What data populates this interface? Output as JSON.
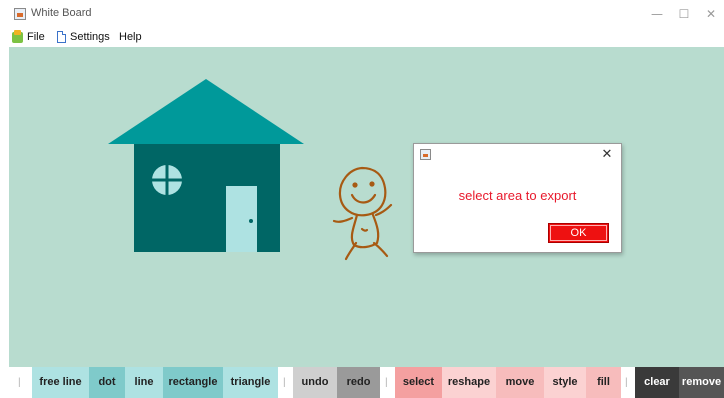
{
  "window": {
    "title": "White Board",
    "app_icon": "java-cup-icon",
    "controls": {
      "minimize": "—",
      "maximize": "☐",
      "close": "✕"
    }
  },
  "menu": {
    "file": "File",
    "settings": "Settings",
    "help": "Help"
  },
  "colors": {
    "canvas_bg": "#b8dccf",
    "roof": "#00999a",
    "house_body": "#006665",
    "door": "#aee2e2",
    "stick_figure": "#a75a13",
    "dialog_text": "#e8192c",
    "ok_button": "#ee1111"
  },
  "dialog": {
    "message": "select area to export",
    "ok_label": "OK",
    "close_glyph": "✕"
  },
  "toolbar": {
    "separator": "|",
    "draw_tools": [
      {
        "label": "free line",
        "color": "#aee2e2"
      },
      {
        "label": "dot",
        "color": "#7fcaca"
      },
      {
        "label": "line",
        "color": "#aee2e2"
      },
      {
        "label": "rectangle",
        "color": "#7fcaca"
      },
      {
        "label": "triangle",
        "color": "#aee2e2"
      }
    ],
    "history_tools": [
      {
        "label": "undo",
        "color": "#cfcfcf"
      },
      {
        "label": "redo",
        "color": "#9a9a9a"
      }
    ],
    "edit_tools": [
      {
        "label": "select",
        "color": "#f4a0a0"
      },
      {
        "label": "reshape",
        "color": "#fbd2d2"
      },
      {
        "label": "move",
        "color": "#f7bcbc"
      },
      {
        "label": "style",
        "color": "#fbd2d2"
      },
      {
        "label": "fill",
        "color": "#f7bcbc"
      }
    ],
    "manage_tools": [
      {
        "label": "clear",
        "color": "#3a3a3a",
        "text_color": "#ffffff"
      },
      {
        "label": "remove",
        "color": "#555555",
        "text_color": "#ffffff"
      }
    ]
  }
}
